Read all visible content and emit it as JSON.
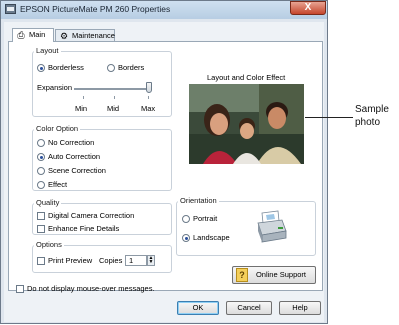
{
  "window": {
    "title": "EPSON PictureMate PM 260 Properties",
    "close_glyph": "X"
  },
  "tabs": [
    {
      "label": "Main",
      "icon": "printer-icon",
      "active": true
    },
    {
      "label": "Maintenance",
      "icon": "maintenance-icon",
      "active": false
    }
  ],
  "layout": {
    "label": "Layout",
    "borderless": "Borderless",
    "borders": "Borders",
    "selected": "Borderless",
    "expansion_label": "Expansion",
    "expansion_ticks": [
      "Min",
      "Mid",
      "Max"
    ],
    "expansion_value": "Max"
  },
  "preview": {
    "label": "Layout and Color Effect",
    "image": "family-photo"
  },
  "color_option": {
    "label": "Color Option",
    "options": [
      "No Correction",
      "Auto Correction",
      "Scene Correction",
      "Effect"
    ],
    "selected": "Auto Correction"
  },
  "quality": {
    "label": "Quality",
    "options": [
      "Digital Camera Correction",
      "Enhance Fine Details"
    ]
  },
  "orientation": {
    "label": "Orientation",
    "options": [
      "Portrait",
      "Landscape"
    ],
    "selected": "Landscape"
  },
  "options": {
    "label": "Options",
    "print_preview": "Print Preview",
    "copies_label": "Copies",
    "copies_value": "1"
  },
  "online_support": "Online Support",
  "mouseover": "Do not display mouse-over messages.",
  "buttons": {
    "ok": "OK",
    "cancel": "Cancel",
    "help": "Help"
  },
  "callout": "Sample photo",
  "colors": {
    "accent": "#2b4f9c",
    "panel_border": "#9aa8b6"
  }
}
